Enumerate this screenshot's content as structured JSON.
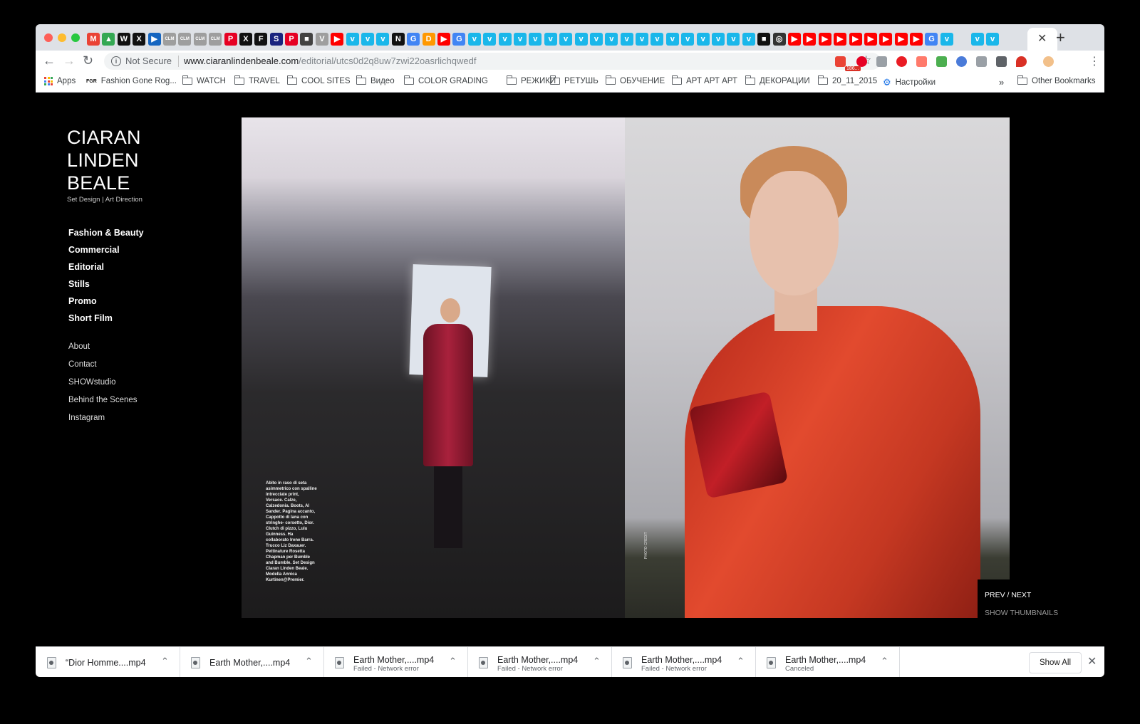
{
  "browser": {
    "tab_close": "✕",
    "new_tab": "+",
    "tab_favicons": [
      {
        "glyph": "M",
        "color": "#ea4335"
      },
      {
        "glyph": "▲",
        "color": "#34a853"
      },
      {
        "glyph": "W",
        "color": "#111111"
      },
      {
        "glyph": "X",
        "color": "#111111"
      },
      {
        "glyph": "▶",
        "color": "#1565c0"
      },
      {
        "glyph": "CLM",
        "color": "#9e9e9e"
      },
      {
        "glyph": "CLM",
        "color": "#9e9e9e"
      },
      {
        "glyph": "CLM",
        "color": "#9e9e9e"
      },
      {
        "glyph": "CLM",
        "color": "#9e9e9e"
      },
      {
        "glyph": "P",
        "color": "#e60023"
      },
      {
        "glyph": "X",
        "color": "#111111"
      },
      {
        "glyph": "F",
        "color": "#111111"
      },
      {
        "glyph": "S",
        "color": "#1a237e"
      },
      {
        "glyph": "P",
        "color": "#e60023"
      },
      {
        "glyph": "■",
        "color": "#424242"
      },
      {
        "glyph": "V",
        "color": "#9e9e9e"
      },
      {
        "glyph": "▶",
        "color": "#ff0000"
      },
      {
        "glyph": "v",
        "color": "#1ab7ea"
      },
      {
        "glyph": "v",
        "color": "#1ab7ea"
      },
      {
        "glyph": "v",
        "color": "#1ab7ea"
      },
      {
        "glyph": "N",
        "color": "#111111"
      },
      {
        "glyph": "G",
        "color": "#4285f4"
      },
      {
        "glyph": "D",
        "color": "#ff9800"
      },
      {
        "glyph": "▶",
        "color": "#ff0000"
      },
      {
        "glyph": "G",
        "color": "#4285f4"
      },
      {
        "glyph": "v",
        "color": "#1ab7ea"
      },
      {
        "glyph": "v",
        "color": "#1ab7ea"
      },
      {
        "glyph": "v",
        "color": "#1ab7ea"
      },
      {
        "glyph": "v",
        "color": "#1ab7ea"
      },
      {
        "glyph": "v",
        "color": "#1ab7ea"
      },
      {
        "glyph": "v",
        "color": "#1ab7ea"
      },
      {
        "glyph": "v",
        "color": "#1ab7ea"
      },
      {
        "glyph": "v",
        "color": "#1ab7ea"
      },
      {
        "glyph": "v",
        "color": "#1ab7ea"
      },
      {
        "glyph": "v",
        "color": "#1ab7ea"
      },
      {
        "glyph": "v",
        "color": "#1ab7ea"
      },
      {
        "glyph": "v",
        "color": "#1ab7ea"
      },
      {
        "glyph": "v",
        "color": "#1ab7ea"
      },
      {
        "glyph": "v",
        "color": "#1ab7ea"
      },
      {
        "glyph": "v",
        "color": "#1ab7ea"
      },
      {
        "glyph": "v",
        "color": "#1ab7ea"
      },
      {
        "glyph": "v",
        "color": "#1ab7ea"
      },
      {
        "glyph": "v",
        "color": "#1ab7ea"
      },
      {
        "glyph": "v",
        "color": "#1ab7ea"
      },
      {
        "glyph": "■",
        "color": "#111111"
      },
      {
        "glyph": "◎",
        "color": "#333333"
      },
      {
        "glyph": "▶",
        "color": "#ff0000"
      },
      {
        "glyph": "▶",
        "color": "#ff0000"
      },
      {
        "glyph": "▶",
        "color": "#ff0000"
      },
      {
        "glyph": "▶",
        "color": "#ff0000"
      },
      {
        "glyph": "▶",
        "color": "#ff0000"
      },
      {
        "glyph": "▶",
        "color": "#ff0000"
      },
      {
        "glyph": "▶",
        "color": "#ff0000"
      },
      {
        "glyph": "▶",
        "color": "#ff0000"
      },
      {
        "glyph": "▶",
        "color": "#ff0000"
      },
      {
        "glyph": "G",
        "color": "#4285f4"
      },
      {
        "glyph": "v",
        "color": "#1ab7ea"
      },
      {
        "glyph": "",
        "color": "#dee1e6"
      },
      {
        "glyph": "v",
        "color": "#1ab7ea"
      },
      {
        "glyph": "v",
        "color": "#1ab7ea"
      }
    ],
    "security_label": "Not Secure",
    "url_host": "www.ciaranlindenbeale.com",
    "url_path": "/editorial/utcs0d2q8uw7zwi22oasrlichqwedf",
    "gmail_badge": "186...",
    "bookmarks": [
      {
        "label": "Apps",
        "icon": "apps-grid"
      },
      {
        "label": "Fashion Gone Rog...",
        "icon": "fgr"
      },
      {
        "label": "WATCH",
        "icon": "folder"
      },
      {
        "label": "TRAVEL",
        "icon": "folder"
      },
      {
        "label": "COOL SITES",
        "icon": "folder"
      },
      {
        "label": "Видео",
        "icon": "folder"
      },
      {
        "label": "COLOR GRADING",
        "icon": "folder"
      },
      {
        "label": "РЕЖИКИ",
        "icon": "folder"
      },
      {
        "label": "РЕТУШЬ",
        "icon": "folder"
      },
      {
        "label": "ОБУЧЕНИЕ",
        "icon": "folder"
      },
      {
        "label": "АРТ АРТ АРТ",
        "icon": "folder"
      },
      {
        "label": "ДЕКОРАЦИИ",
        "icon": "folder"
      },
      {
        "label": "20_11_2015",
        "icon": "folder"
      },
      {
        "label": "Настройки",
        "icon": "gear"
      }
    ],
    "bookmarks_overflow": "»",
    "other_bookmarks": "Other Bookmarks",
    "fgr_icon_text": "FGR"
  },
  "site": {
    "title_lines": [
      "CIARAN",
      "LINDEN",
      "BEALE"
    ],
    "subtitle": "Set Design  |  Art Direction",
    "nav_main": [
      "Fashion & Beauty",
      "Commercial",
      "Editorial",
      "Stills",
      "Promo",
      "Short Film"
    ],
    "nav_secondary": [
      "About",
      "Contact",
      "SHOWstudio",
      "Behind the Scenes",
      "Instagram"
    ],
    "prev_next": "PREV / NEXT",
    "show_thumbnails": "SHOW THUMBNAILS",
    "photo_caption": "Abito in raso di seta asimmetrico con spalline intrecciate print, Versace. Calze, Calzedonia. Boots, Al Sander. Pagina accanto, Cappotto di lana con stringhe- corsetto, Dior. Clutch di pizzo, Lulu Guinness. Ha collaborato Irene Barra. Trucco Liz Daxauer. Pettinature Rosetta Chapman per Bumble and Bumble. Set Design Ciaran Linden Beale. Modella Annica Kurtinen@Premier.",
    "photo_credit": "PHOTO CREDIT"
  },
  "downloads": {
    "items": [
      {
        "name": "“Dior Homme....mp4",
        "status": ""
      },
      {
        "name": "Earth Mother,....mp4",
        "status": ""
      },
      {
        "name": "Earth Mother,....mp4",
        "status": "Failed - Network error"
      },
      {
        "name": "Earth Mother,....mp4",
        "status": "Failed - Network error"
      },
      {
        "name": "Earth Mother,....mp4",
        "status": "Failed - Network error"
      },
      {
        "name": "Earth Mother,....mp4",
        "status": "Canceled"
      }
    ],
    "show_all": "Show All",
    "close": "✕"
  },
  "colors": {
    "page_bg": "#000000",
    "tabstrip_bg": "#dee1e6",
    "nav_text": "#ffffff",
    "coat_red": "#d9452b",
    "dress_red": "#a9213c"
  }
}
